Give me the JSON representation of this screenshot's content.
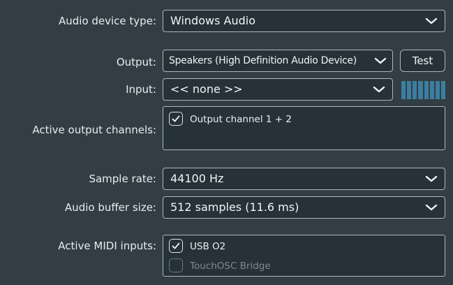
{
  "settings": {
    "device_type_label": "Audio device type:",
    "device_type_value": "Windows Audio",
    "output_label": "Output:",
    "output_value": "Speakers (High Definition Audio Device)",
    "test_button": "Test",
    "input_label": "Input:",
    "input_value": "<< none >>",
    "active_output_label": "Active output channels:",
    "output_channels": [
      {
        "label": "Output channel 1 + 2",
        "checked": true
      }
    ],
    "sample_rate_label": "Sample rate:",
    "sample_rate_value": "44100 Hz",
    "buffer_label": "Audio buffer size:",
    "buffer_value": "512 samples (11.6 ms)",
    "midi_label": "Active MIDI inputs:",
    "midi_inputs": [
      {
        "label": "USB O2",
        "checked": true
      },
      {
        "label": "TouchOSC Bridge",
        "checked": false
      }
    ]
  },
  "icons": {
    "dropdown": "chevron-down-icon",
    "check": "check-icon",
    "meter": "input-level-meter"
  },
  "colors": {
    "background": "#323e44",
    "field_background": "#263238",
    "meter": "#3c7ea0",
    "disabled_text": "#7e898e"
  }
}
